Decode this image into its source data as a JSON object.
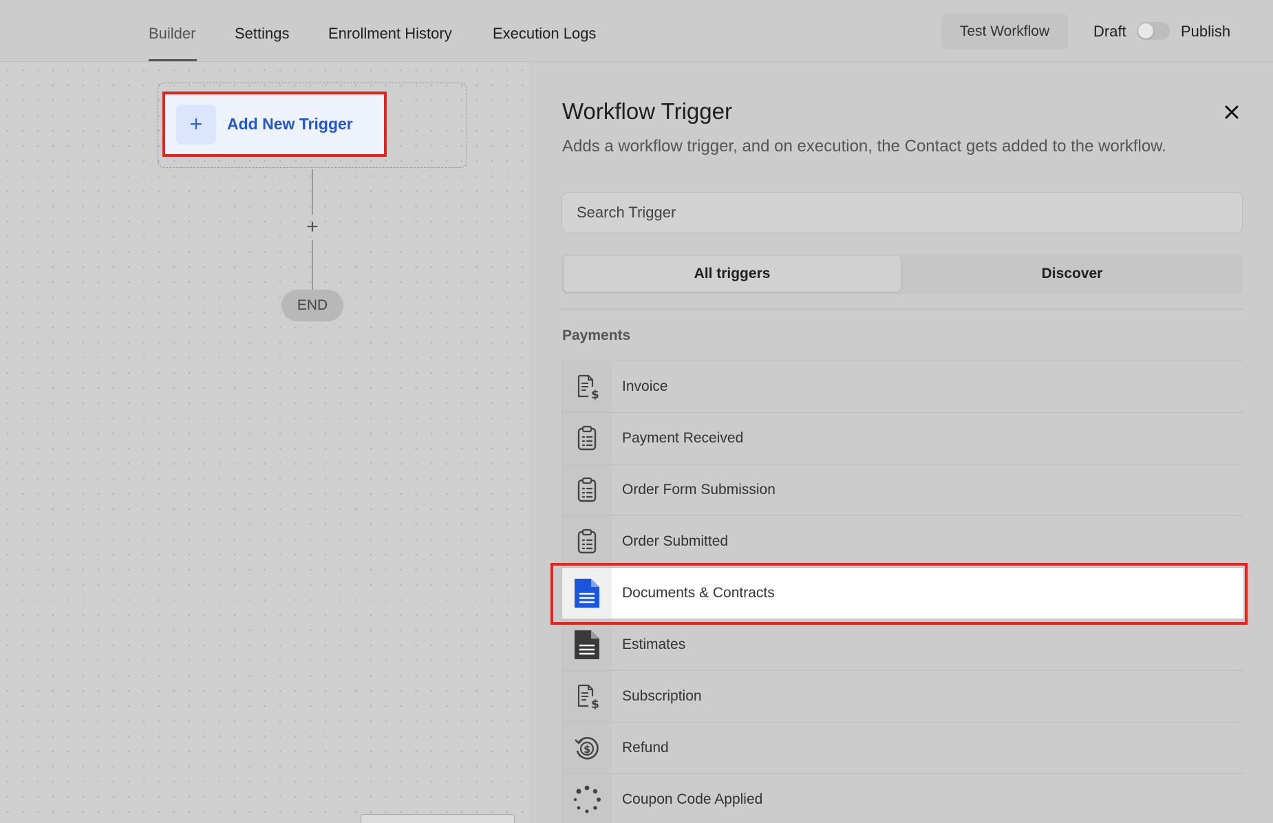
{
  "header": {
    "tabs": [
      {
        "label": "Builder",
        "active": true
      },
      {
        "label": "Settings",
        "active": false
      },
      {
        "label": "Enrollment History",
        "active": false
      },
      {
        "label": "Execution Logs",
        "active": false
      }
    ],
    "test_button": "Test Workflow",
    "draft_label": "Draft",
    "publish_label": "Publish",
    "publish_toggle_on": false
  },
  "canvas": {
    "add_trigger_label": "Add New Trigger",
    "end_label": "END"
  },
  "panel": {
    "title": "Workflow Trigger",
    "subtitle": "Adds a workflow trigger, and on execution, the Contact gets added to the workflow.",
    "search_placeholder": "Search Trigger",
    "tabs": [
      "All triggers",
      "Discover"
    ],
    "section": "Payments",
    "items": [
      {
        "label": "Invoice",
        "icon": "invoice-dollar-icon"
      },
      {
        "label": "Payment Received",
        "icon": "clipboard-list-icon"
      },
      {
        "label": "Order Form Submission",
        "icon": "clipboard-list-icon"
      },
      {
        "label": "Order Submitted",
        "icon": "clipboard-list-icon"
      },
      {
        "label": "Documents & Contracts",
        "icon": "document-icon",
        "highlighted": true
      },
      {
        "label": "Estimates",
        "icon": "document-icon"
      },
      {
        "label": "Subscription",
        "icon": "invoice-dollar-icon"
      },
      {
        "label": "Refund",
        "icon": "refund-icon"
      },
      {
        "label": "Coupon Code Applied",
        "icon": "loading-dots-icon"
      }
    ]
  },
  "colors": {
    "accent_blue": "#2457c8",
    "highlight_red": "#e8231b",
    "doc_icon_blue": "#1a56db"
  }
}
